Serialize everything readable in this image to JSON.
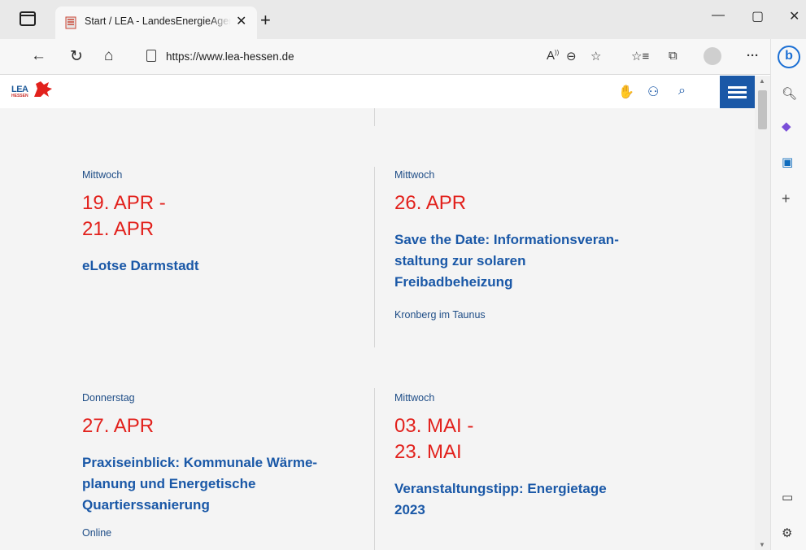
{
  "browser": {
    "tab_title": "Start / LEA - LandesEnergieAgentur Hessen",
    "tab_close": "✕",
    "new_tab": "+",
    "url": "https://www.lea-hessen.de",
    "window_min": "—",
    "window_max": "▢",
    "window_close": "✕",
    "toolbar_icons": [
      "back-icon",
      "refresh-icon",
      "home-icon",
      "read-aloud-icon",
      "zoom-icon",
      "add-favorite-icon",
      "favorites-icon",
      "collections-icon",
      "profile-icon",
      "more-icon"
    ],
    "more": "···"
  },
  "edge_sidebar": {
    "bing": "b",
    "icons": [
      "search-icon",
      "copilot-icon",
      "outlook-icon",
      "add-icon",
      "sidebar-toggle-icon",
      "settings-icon"
    ]
  },
  "site": {
    "logo_text": "LEA",
    "logo_sub": "HESSEN",
    "header_icons": [
      "sign-language-icon",
      "easy-language-icon",
      "search-icon",
      "menu-icon"
    ]
  },
  "events": [
    {
      "day": "Mittwoch",
      "date_line1": "19. APR -",
      "date_line2": "21. APR",
      "title": "eLotse Darmstadt",
      "location": ""
    },
    {
      "day": "Mittwoch",
      "date_line1": "26. APR",
      "date_line2": "",
      "title": "Save the Date: Informationsveran-staltung zur solaren Freibadbeheizung",
      "title_lines": [
        "Save the Date: Informationsveran-",
        "staltung zur solaren",
        "Freibadbeheizung"
      ],
      "location": "Kronberg im Taunus"
    },
    {
      "day": "Donnerstag",
      "date_line1": "27. APR",
      "date_line2": "",
      "title_lines": [
        "Praxiseinblick: Kommunale Wärme-",
        "planung und Energetische",
        "Quartierssanierung"
      ],
      "location": "Online"
    },
    {
      "day": "Mittwoch",
      "date_line1": "03. MAI -",
      "date_line2": "23. MAI",
      "title_lines": [
        "Veranstaltungstipp: Energietage",
        "2023"
      ],
      "location": ""
    }
  ],
  "colors": {
    "accent_blue": "#1a58a7",
    "date_red": "#e2211c",
    "page_bg": "#f4f4f4"
  }
}
